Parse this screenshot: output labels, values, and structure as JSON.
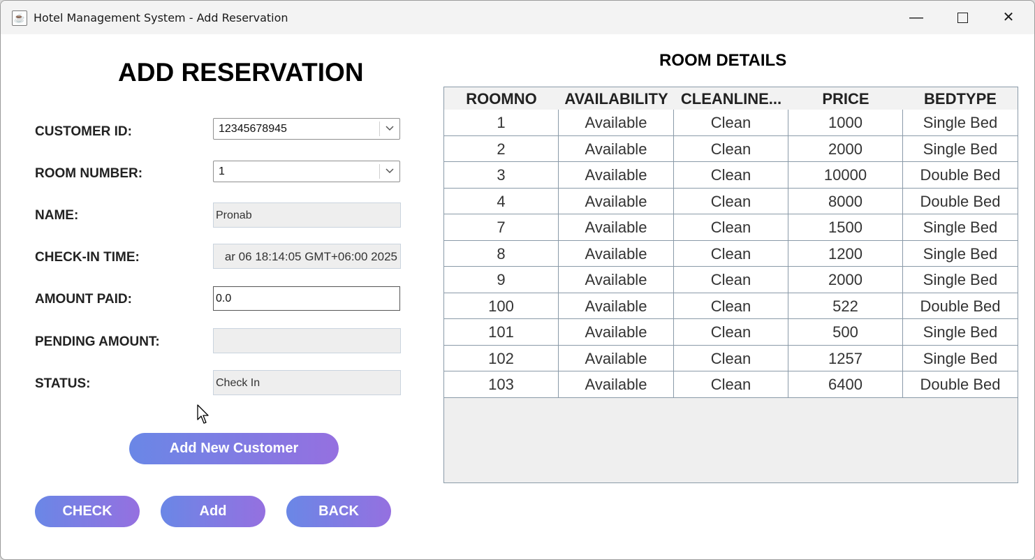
{
  "window": {
    "title": "Hotel Management System - Add Reservation",
    "controls": {
      "minimize": "—",
      "close": "✕"
    }
  },
  "form": {
    "heading": "ADD RESERVATION",
    "customer_id": {
      "label": "CUSTOMER ID:",
      "value": "12345678945"
    },
    "room_number": {
      "label": "ROOM NUMBER:",
      "value": "1"
    },
    "name": {
      "label": "NAME:",
      "value": "Pronab"
    },
    "checkin_time": {
      "label": "CHECK-IN TIME:",
      "value": "ar 06 18:14:05 GMT+06:00 2025"
    },
    "amount_paid": {
      "label": "AMOUNT PAID:",
      "value": "0.0"
    },
    "pending_amount": {
      "label": "PENDING AMOUNT:",
      "value": ""
    },
    "status": {
      "label": "STATUS:",
      "value": "Check In"
    },
    "buttons": {
      "add_new_customer": "Add New Customer",
      "check": "CHECK",
      "add": "Add",
      "back": "BACK"
    }
  },
  "room_details": {
    "title": "ROOM DETAILS",
    "columns": [
      "ROOMNO",
      "AVAILABILITY",
      "CLEANLINE...",
      "PRICE",
      "BEDTYPE"
    ],
    "rows": [
      [
        "1",
        "Available",
        "Clean",
        "1000",
        "Single Bed"
      ],
      [
        "2",
        "Available",
        "Clean",
        "2000",
        "Single Bed"
      ],
      [
        "3",
        "Available",
        "Clean",
        "10000",
        "Double Bed"
      ],
      [
        "4",
        "Available",
        "Clean",
        "8000",
        "Double Bed"
      ],
      [
        "7",
        "Available",
        "Clean",
        "1500",
        "Single Bed"
      ],
      [
        "8",
        "Available",
        "Clean",
        "1200",
        "Single Bed"
      ],
      [
        "9",
        "Available",
        "Clean",
        "2000",
        "Single Bed"
      ],
      [
        "100",
        "Available",
        "Clean",
        "522",
        "Double Bed"
      ],
      [
        "101",
        "Available",
        "Clean",
        "500",
        "Single Bed"
      ],
      [
        "102",
        "Available",
        "Clean",
        "1257",
        "Single Bed"
      ],
      [
        "103",
        "Available",
        "Clean",
        "6400",
        "Double Bed"
      ]
    ]
  },
  "icons": {
    "app": "java-app-icon",
    "dropdown": "chevron-down-icon",
    "cursor": "mouse-pointer-icon"
  }
}
